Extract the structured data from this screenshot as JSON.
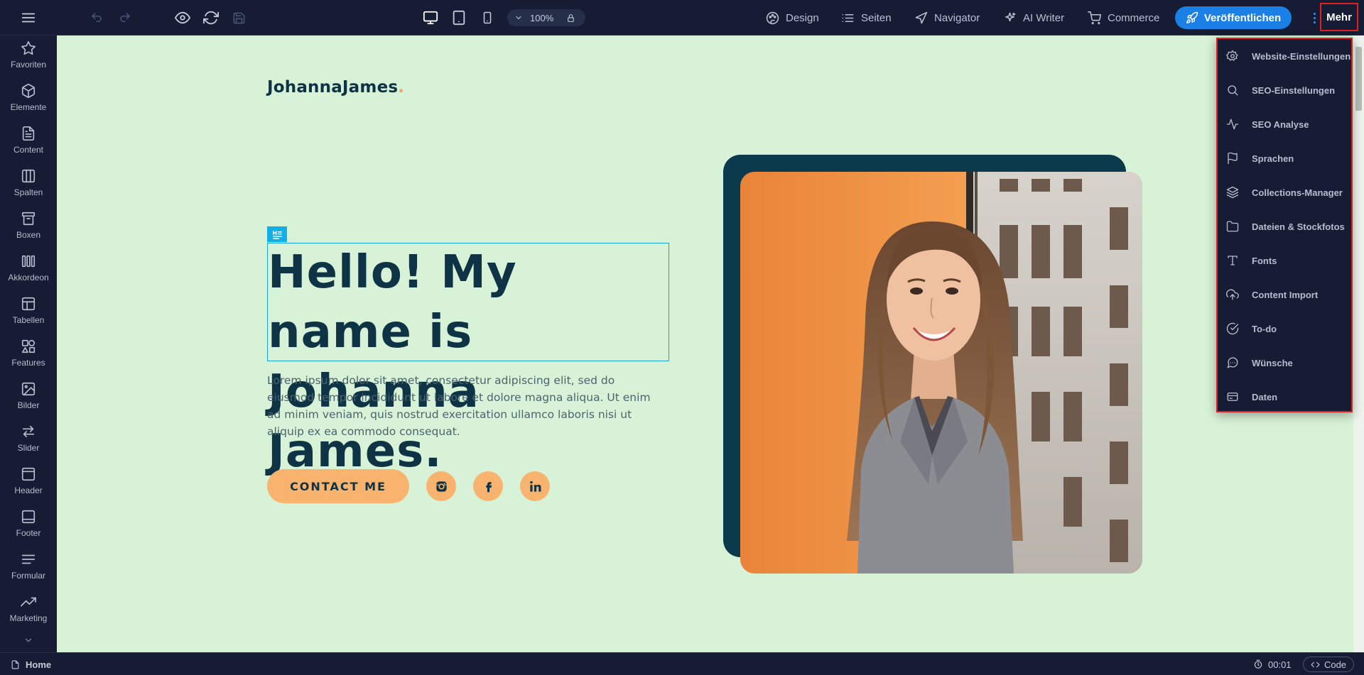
{
  "toolbar": {
    "menu_icon": "hamburger-icon",
    "zoom_value": "100%",
    "design_label": "Design",
    "pages_label": "Seiten",
    "navigator_label": "Navigator",
    "ai_writer_label": "AI Writer",
    "commerce_label": "Commerce",
    "publish_label": "Veröffentlichen",
    "more_label": "Mehr"
  },
  "sidebar": {
    "items": [
      {
        "label": "Favoriten",
        "icon": "star-icon"
      },
      {
        "label": "Elemente",
        "icon": "cube-icon"
      },
      {
        "label": "Content",
        "icon": "document-icon"
      },
      {
        "label": "Spalten",
        "icon": "columns-icon"
      },
      {
        "label": "Boxen",
        "icon": "box-icon"
      },
      {
        "label": "Akkordeon",
        "icon": "accordion-icon"
      },
      {
        "label": "Tabellen",
        "icon": "table-icon"
      },
      {
        "label": "Features",
        "icon": "features-icon"
      },
      {
        "label": "Bilder",
        "icon": "image-icon"
      },
      {
        "label": "Slider",
        "icon": "slider-icon"
      },
      {
        "label": "Header",
        "icon": "header-icon"
      },
      {
        "label": "Footer",
        "icon": "footer-icon"
      },
      {
        "label": "Formular",
        "icon": "form-icon"
      },
      {
        "label": "Marketing",
        "icon": "trending-icon"
      }
    ]
  },
  "canvas": {
    "logo_text": "JohannaJames",
    "logo_dot": ".",
    "headline": "Hello! My name is Johanna James.",
    "paragraph": "Lorem ipsum dolor sit amet, consectetur adipiscing elit, sed do eiusmod tempor incididunt ut labore et dolore magna aliqua. Ut enim ad minim veniam, quis nostrud exercitation ullamco laboris nisi ut aliquip ex ea commodo consequat.",
    "cta_label": "CONTACT ME",
    "social": [
      "instagram-icon",
      "facebook-icon",
      "linkedin-icon"
    ],
    "colors": {
      "background": "#d8f2d7",
      "accent": "#f8b36f",
      "dark": "#0e3344"
    }
  },
  "more_menu": {
    "items": [
      {
        "label": "Website-Einstellungen",
        "icon": "settings-icon"
      },
      {
        "label": "SEO-Einstellungen",
        "icon": "search-icon"
      },
      {
        "label": "SEO Analyse",
        "icon": "activity-icon"
      },
      {
        "label": "Sprachen",
        "icon": "flag-icon"
      },
      {
        "label": "Collections-Manager",
        "icon": "layers-icon"
      },
      {
        "label": "Dateien & Stockfotos",
        "icon": "folder-icon"
      },
      {
        "label": "Fonts",
        "icon": "type-icon"
      },
      {
        "label": "Content Import",
        "icon": "upload-cloud-icon"
      },
      {
        "label": "To-do",
        "icon": "check-circle-icon"
      },
      {
        "label": "Wünsche",
        "icon": "message-icon"
      },
      {
        "label": "Daten",
        "icon": "database-icon"
      }
    ]
  },
  "bottombar": {
    "home_label": "Home",
    "timer": "00:01",
    "code_label": "Code"
  }
}
